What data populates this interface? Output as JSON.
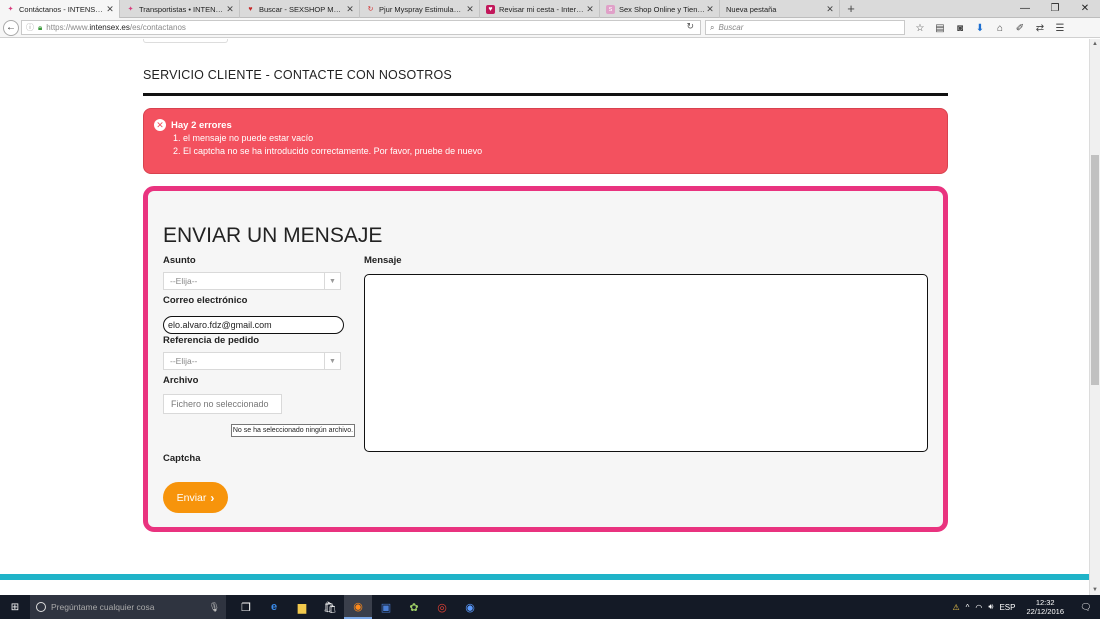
{
  "browser": {
    "tabs": [
      {
        "label": "Contáctanos - INTENSEX ...",
        "icon": "intensex-favicon",
        "color": "#d83a7c",
        "active": true
      },
      {
        "label": "Transportistas • INTENSEX...",
        "icon": "intensex-favicon",
        "color": "#d83a7c",
        "active": false
      },
      {
        "label": "Buscar - SEXSHOP Mundo...",
        "icon": "heart-favicon",
        "color": "#c62828",
        "active": false
      },
      {
        "label": "Pjur Myspray Estimulante ...",
        "icon": "swirl-favicon",
        "color": "#d32f2f",
        "active": false
      },
      {
        "label": "Revisar mi cesta - Internati...",
        "icon": "heart-box-favicon",
        "color": "#c2185b",
        "active": false
      },
      {
        "label": "Sex Shop Online y Tienda ...",
        "icon": "shop-favicon",
        "color": "#e0a0c8",
        "active": false
      },
      {
        "label": "Nueva pestaña",
        "icon": "",
        "color": "",
        "active": false
      }
    ],
    "url_prefix": "https://www.",
    "url_domain": "intensex.es",
    "url_path": "/es/contactanos",
    "search_placeholder": "Buscar"
  },
  "page": {
    "heading": "SERVICIO CLIENTE - CONTACTE CON NOSOTROS",
    "alert": {
      "title": "Hay 2 errores",
      "errors": [
        "1. el mensaje no puede estar vacío",
        "2. El captcha no se ha introducido correctamente. Por favor, pruebe de nuevo"
      ]
    },
    "form": {
      "title": "ENVIAR UN MENSAJE",
      "subject_label": "Asunto",
      "subject_value": "--Elija--",
      "email_label": "Correo electrónico",
      "email_value": "elo.alvaro.fdz@gmail.com",
      "order_label": "Referencia de pedido",
      "order_value": "--Elija--",
      "file_label": "Archivo",
      "file_value": "Fichero no seleccionado",
      "file_tooltip": "No se ha seleccionado ningún archivo.",
      "message_label": "Mensaje",
      "message_value": "",
      "captcha_label": "Captcha",
      "send_label": "Enviar"
    }
  },
  "taskbar": {
    "search_placeholder": "Pregúntame cualquier cosa",
    "language": "ESP",
    "time": "12:32",
    "date": "22/12/2016"
  },
  "colors": {
    "alert_bg": "#f3515f",
    "form_border": "#e9337f",
    "send_button": "#f7940b",
    "footer_band": "#1fb3c8"
  }
}
